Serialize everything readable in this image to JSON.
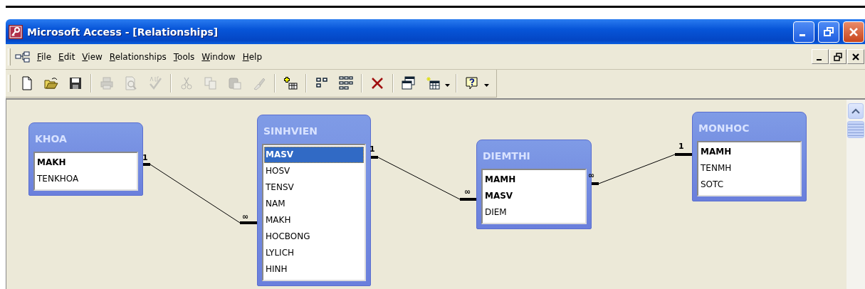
{
  "window": {
    "title": "Microsoft Access - [Relationships]"
  },
  "menu": [
    "File",
    "Edit",
    "View",
    "Relationships",
    "Tools",
    "Window",
    "Help"
  ],
  "toolbar": [
    {
      "kind": "new",
      "disabled": false
    },
    {
      "kind": "open",
      "disabled": false
    },
    {
      "kind": "save",
      "disabled": false
    },
    {
      "kind": "sep"
    },
    {
      "kind": "print",
      "disabled": true
    },
    {
      "kind": "preview",
      "disabled": true
    },
    {
      "kind": "spelling",
      "disabled": true
    },
    {
      "kind": "sep"
    },
    {
      "kind": "cut",
      "disabled": true
    },
    {
      "kind": "copy",
      "disabled": true
    },
    {
      "kind": "paste",
      "disabled": true
    },
    {
      "kind": "painter",
      "disabled": true
    },
    {
      "kind": "sep"
    },
    {
      "kind": "showtable",
      "disabled": false
    },
    {
      "kind": "sep"
    },
    {
      "kind": "direct",
      "disabled": false
    },
    {
      "kind": "all",
      "disabled": false
    },
    {
      "kind": "sep"
    },
    {
      "kind": "delete",
      "disabled": false
    },
    {
      "kind": "sep"
    },
    {
      "kind": "windows",
      "disabled": false
    },
    {
      "kind": "newobject",
      "disabled": false
    },
    {
      "kind": "caret"
    },
    {
      "kind": "sep"
    },
    {
      "kind": "help",
      "disabled": false
    },
    {
      "kind": "caret"
    }
  ],
  "tables": [
    {
      "name": "KHOA",
      "fields": [
        {
          "name": "MAKH",
          "key": true,
          "selected": false
        },
        {
          "name": "TENKHOA",
          "key": false,
          "selected": false
        }
      ]
    },
    {
      "name": "SINHVIEN",
      "fields": [
        {
          "name": "MASV",
          "key": true,
          "selected": true
        },
        {
          "name": "HOSV",
          "key": false,
          "selected": false
        },
        {
          "name": "TENSV",
          "key": false,
          "selected": false
        },
        {
          "name": "NAM",
          "key": false,
          "selected": false
        },
        {
          "name": "MAKH",
          "key": false,
          "selected": false
        },
        {
          "name": "HOCBONG",
          "key": false,
          "selected": false
        },
        {
          "name": "LYLICH",
          "key": false,
          "selected": false
        },
        {
          "name": "HINH",
          "key": false,
          "selected": false
        }
      ]
    },
    {
      "name": "DIEMTHI",
      "fields": [
        {
          "name": "MAMH",
          "key": true,
          "selected": false
        },
        {
          "name": "MASV",
          "key": true,
          "selected": false
        },
        {
          "name": "DIEM",
          "key": false,
          "selected": false
        }
      ]
    },
    {
      "name": "MONHOC",
      "fields": [
        {
          "name": "MAMH",
          "key": true,
          "selected": false
        },
        {
          "name": "TENMH",
          "key": false,
          "selected": false
        },
        {
          "name": "SOTC",
          "key": false,
          "selected": false
        }
      ]
    }
  ],
  "relationships": [
    {
      "left_label": "1",
      "right_label": "∞"
    },
    {
      "left_label": "1",
      "right_label": "∞"
    },
    {
      "left_label": "∞",
      "right_label": "1"
    }
  ]
}
